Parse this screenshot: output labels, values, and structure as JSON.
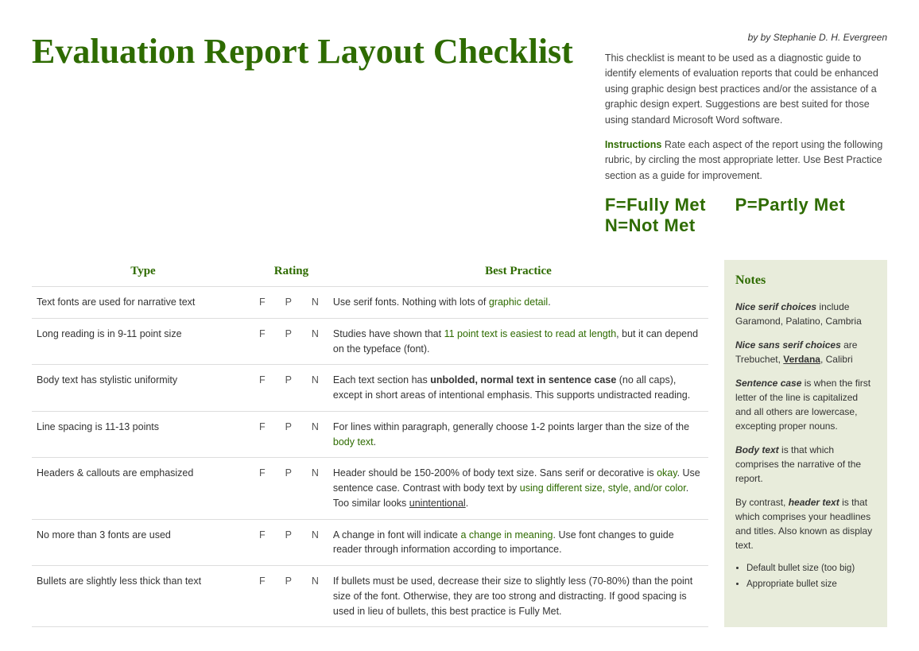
{
  "byline": "by Stephanie D. H. Evergreen",
  "title": "Evaluation Report Layout Checklist",
  "description": "This checklist is meant to be used as a diagnostic guide to identify elements of evaluation reports that could be enhanced using graphic design best practices and/or the assistance of a graphic design expert. Suggestions are best suited for those using standard Microsoft Word software.",
  "instructions_label": "Instructions",
  "instructions_text": " Rate each aspect of the report using the following rubric, by circling the most appropriate letter. Use Best Practice section as a guide for improvement.",
  "rubric": [
    {
      "label": "F=Fully Met"
    },
    {
      "label": "P=Partly Met"
    },
    {
      "label": "N=Not Met"
    }
  ],
  "columns": {
    "type": "Type",
    "rating": "Rating",
    "best_practice": "Best Practice"
  },
  "rows": [
    {
      "type": "Text fonts are used for narrative text",
      "rating": "F  P  N",
      "best_practice": "Use serif fonts. Nothing with lots of graphic detail."
    },
    {
      "type": "Long reading is in 9-11 point size",
      "rating": "F  P  N",
      "best_practice": "Studies have shown that 11 point text is easiest to read at length, but it can depend on the typeface (font)."
    },
    {
      "type": "Body text has stylistic uniformity",
      "rating": "F  P  N",
      "best_practice": "Each text section has unbolded, normal text in sentence case (no all caps), except in short areas of intentional emphasis. This supports undistracted reading."
    },
    {
      "type": "Line spacing is 11-13 points",
      "rating": "F  P  N",
      "best_practice": "For lines within paragraph, generally choose 1-2 points larger than the size of the body text."
    },
    {
      "type": "Headers & callouts are emphasized",
      "rating": "F  P  N",
      "best_practice": "Header should be 150-200% of body text size. Sans serif or decorative is okay. Use sentence case. Contrast with body text by using different size, style, and/or color. Too similar looks unintentional."
    },
    {
      "type": "No more than 3 fonts are used",
      "rating": "F  P  N",
      "best_practice": "A change in font will indicate a change in meaning. Use font changes to guide reader through information according to importance."
    },
    {
      "type": "Bullets are slightly less thick than text",
      "rating": "F  P  N",
      "best_practice": "If bullets must be used, decrease their size to slightly less (70-80%) than the point size of the font. Otherwise, they are too strong and distracting. If good spacing is used in lieu of bullets, this best practice is Fully Met."
    }
  ],
  "notes": {
    "title": "Notes",
    "blocks": [
      {
        "id": "serif-choices",
        "italic_bold": "Nice serif choices",
        "rest": " include Garamond, Palatino, Cambria"
      },
      {
        "id": "sans-serif-choices",
        "italic_bold": "Nice sans serif choices",
        "rest": " are Trebuchet, Verdana, Calibri"
      },
      {
        "id": "sentence-case",
        "italic_bold": "Sentence case",
        "rest": " is when the first letter of the line is capitalized and all others are lowercase, excepting proper nouns."
      },
      {
        "id": "body-text",
        "italic_bold": "Body text",
        "rest": " is that which comprises the narrative of the report."
      },
      {
        "id": "header-text",
        "text_start": "By contrast, ",
        "italic_bold": "header text",
        "rest": " is that which comprises your headlines and titles. Also known as display text."
      },
      {
        "id": "bullets",
        "is_list": true,
        "items": [
          "Default bullet size (too big)",
          "Appropriate bullet size"
        ]
      }
    ]
  }
}
